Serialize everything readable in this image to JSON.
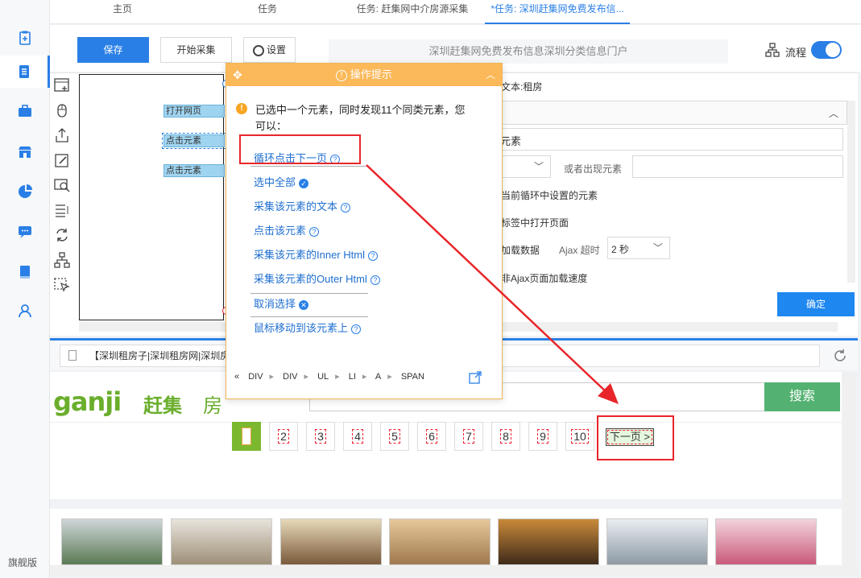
{
  "sidebar": {
    "footer_label": "旗舰版"
  },
  "tabs": [
    {
      "label": "主页"
    },
    {
      "label": "任务"
    },
    {
      "label": "任务: 赶集网中介房源采集"
    },
    {
      "label": "*任务: 深圳赶集网免费发布信..."
    }
  ],
  "toolbar": {
    "save_label": "保存",
    "start_label": "开始采集",
    "settings_label": "设置",
    "page_title": "深圳赶集网免费发布信息深圳分类信息门户",
    "flow_label": "流程"
  },
  "workflow": {
    "nodes": [
      "打开网页",
      "点击元素",
      "点击元素"
    ],
    "right_panel": {
      "text_label": "文本:租房",
      "element_label": "元素",
      "or_label": "或者出现元素",
      "loop_text": "当前循环中设置的元素",
      "newtab_text": "标签中打开页面",
      "ajax_text": "加载数据",
      "ajax_timeout_label": "Ajax 超时",
      "ajax_timeout_value": "2 秒",
      "speed_text": "非Ajax页面加载速度",
      "confirm_label": "确定"
    }
  },
  "browser": {
    "url_text": "【深圳租房子|深圳租房网|深圳房"
  },
  "webpage": {
    "logo_text": "ganji",
    "logo_cn": "赶集",
    "logo_sub": "房",
    "search_button": "搜索",
    "pages": [
      "1",
      "2",
      "3",
      "4",
      "5",
      "6",
      "7",
      "8",
      "9",
      "10"
    ],
    "next_page": "下一页 >"
  },
  "popup": {
    "title": "操作提示",
    "message": "已选中一个元素，同时发现11个同类元素，您可以：",
    "actions": [
      "循环点击下一页",
      "选中全部",
      "采集该元素的文本",
      "点击该元素",
      "采集该元素的Inner Html",
      "采集该元素的Outer Html",
      "取消选择",
      "鼠标移动到该元素上"
    ],
    "breadcrumb": [
      "DIV",
      "DIV",
      "UL",
      "LI",
      "A",
      "SPAN"
    ]
  },
  "colors": {
    "accent": "#2a7fe6",
    "popup_header": "#fbb959",
    "annotation": "#e8262a",
    "ganji_green": "#6aae2c"
  }
}
